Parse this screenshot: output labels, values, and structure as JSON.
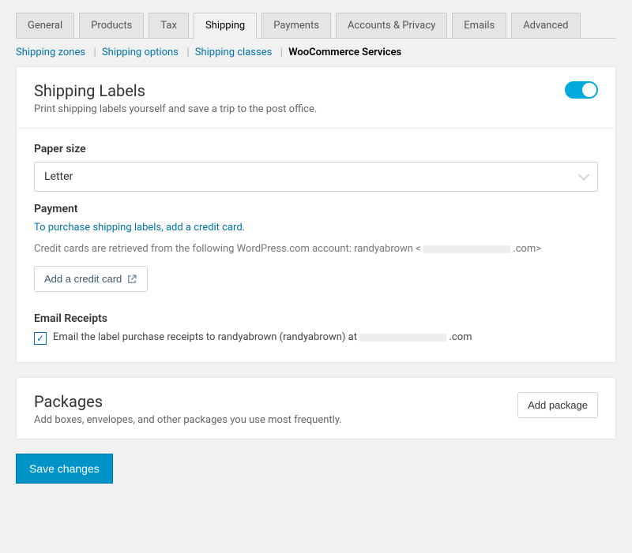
{
  "tabs": {
    "general": "General",
    "products": "Products",
    "tax": "Tax",
    "shipping": "Shipping",
    "payments": "Payments",
    "accounts": "Accounts & Privacy",
    "emails": "Emails",
    "advanced": "Advanced"
  },
  "subtabs": {
    "zones": "Shipping zones",
    "options": "Shipping options",
    "classes": "Shipping classes",
    "services": "WooCommerce Services"
  },
  "labels_card": {
    "title": "Shipping Labels",
    "subtitle": "Print shipping labels yourself and save a trip to the post office."
  },
  "paper": {
    "label": "Paper size",
    "value": "Letter"
  },
  "payment": {
    "label": "Payment",
    "help": "To purchase shipping labels, add a credit card.",
    "desc_prefix": "Credit cards are retrieved from the following WordPress.com account: randyabrown <",
    "desc_suffix": ".com>",
    "button": "Add a credit card"
  },
  "receipts": {
    "label": "Email Receipts",
    "text_prefix": "Email the label purchase receipts to randyabrown (randyabrown) at ",
    "text_suffix": ".com"
  },
  "packages_card": {
    "title": "Packages",
    "subtitle": "Add boxes, envelopes, and other packages you use most frequently.",
    "button": "Add package"
  },
  "footer": {
    "save": "Save changes"
  }
}
